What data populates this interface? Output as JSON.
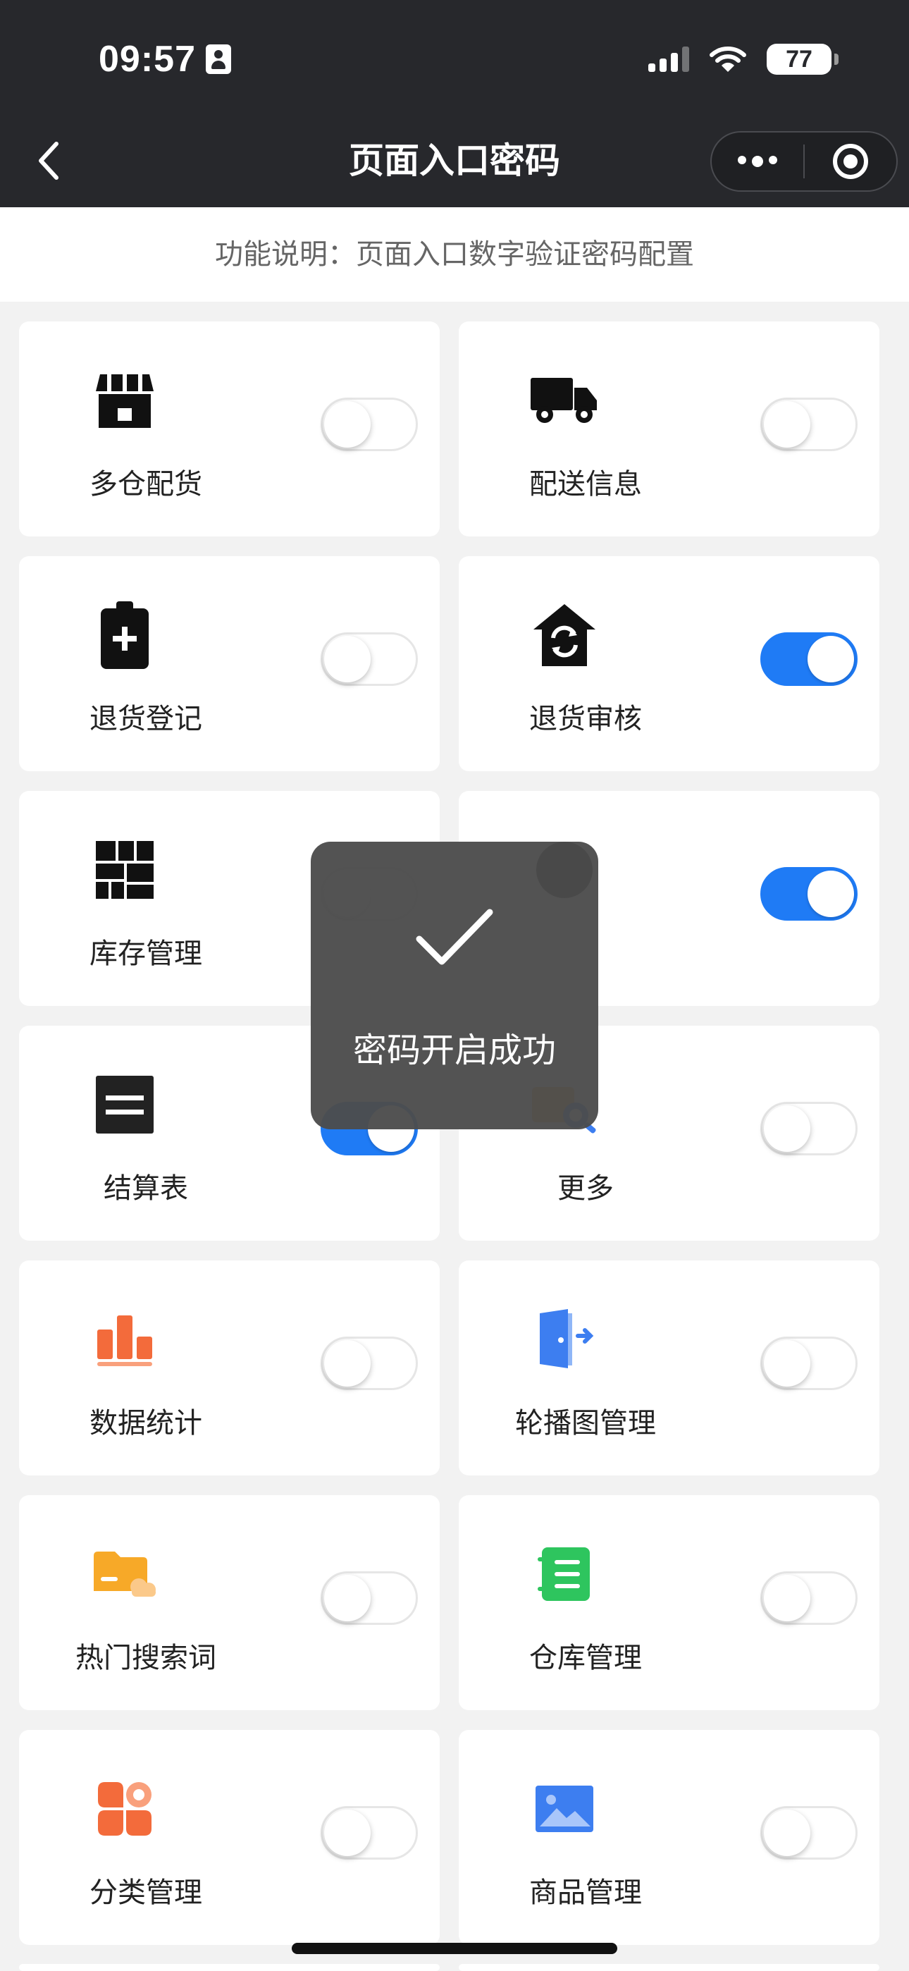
{
  "status_bar": {
    "time": "09:57",
    "battery": "77"
  },
  "nav": {
    "title": "页面入口密码"
  },
  "description": "功能说明：页面入口数字验证密码配置",
  "items": [
    {
      "label": "多仓配货",
      "icon": "store-icon",
      "on": false
    },
    {
      "label": "配送信息",
      "icon": "truck-icon",
      "on": false
    },
    {
      "label": "退货登记",
      "icon": "clipboard-plus-icon",
      "on": false
    },
    {
      "label": "退货审核",
      "icon": "house-refresh-icon",
      "on": true
    },
    {
      "label": "库存管理",
      "icon": "grid-blocks-icon",
      "on": false
    },
    {
      "label": "",
      "icon": "circle-icon",
      "on": true
    },
    {
      "label": "结算表",
      "icon": "equals-square-icon",
      "on": true
    },
    {
      "label": "更多",
      "icon": "search-folder-icon",
      "on": false
    },
    {
      "label": "数据统计",
      "icon": "bar-chart-icon",
      "on": false
    },
    {
      "label": "轮播图管理",
      "icon": "door-exit-icon",
      "on": false
    },
    {
      "label": "热门搜索词",
      "icon": "folder-cloud-icon",
      "on": false
    },
    {
      "label": "仓库管理",
      "icon": "notebook-list-icon",
      "on": false
    },
    {
      "label": "分类管理",
      "icon": "category-grid-icon",
      "on": false
    },
    {
      "label": "商品管理",
      "icon": "image-icon",
      "on": false
    }
  ],
  "toast": {
    "message": "密码开启成功"
  },
  "colors": {
    "toggle_on": "#1f7bf5",
    "topbar": "#27282c"
  }
}
